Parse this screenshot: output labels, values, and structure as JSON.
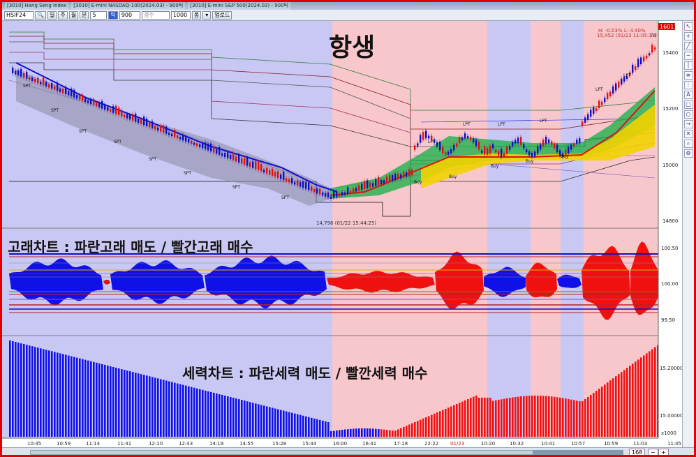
{
  "window": {
    "tabs": [
      "[3010] Hang Seng Index",
      "[3010] E-mini NASDAQ-100(2024.03) - 900틱",
      "[3010] E-mini S&P 500(2024.03) - 900틱"
    ]
  },
  "toolbar": {
    "symbol": "HSIF24",
    "buttons": [
      "일",
      "주",
      "월",
      "분",
      "틱"
    ],
    "interval": "5",
    "tick_count": "900",
    "type_label": "갱수",
    "count_value": "1000",
    "count_unit": "봉",
    "update_label": "업로드"
  },
  "title": "항생",
  "legend": {
    "high_low": "H: -0.03%  L: 4.40%",
    "last_info": "15,452 (01/23 11:05:11)",
    "last_sub": "74",
    "current_price": "16011"
  },
  "annotations": {
    "low_marker": "14,796 (01/22 15:44:25)"
  },
  "panels": {
    "whale_title": "고래차트 : 파란고래 매도 / 빨간고래 매수",
    "force_title": "세력차트 : 파란세력 매도 / 빨깐세력 매수"
  },
  "axes": {
    "price_ticks": [
      "15400",
      "15200",
      "15000",
      "14800"
    ],
    "whale_ticks": [
      "100.50",
      "100.00",
      "99.50"
    ],
    "force_ticks": [
      "15.20000",
      "15.00000"
    ],
    "force_unit": "x1000",
    "time_ticks": [
      "10:45",
      "10:59",
      "11:14",
      "11:41",
      "12:10",
      "12:43",
      "14:19",
      "14:55",
      "15:28",
      "15:44",
      "16:00",
      "16:41",
      "17:18",
      "22:22",
      "01/23",
      "10:20",
      "10:32",
      "10:41",
      "10:57",
      "10:59",
      "11:03",
      "11:05"
    ]
  },
  "bottom": {
    "scroll_value": "168"
  },
  "colors": {
    "sell_blue": "#1010e8",
    "buy_red": "#f01010",
    "bg_blue": "#c9c8f4",
    "bg_pink": "#f7c7cc",
    "frame": "#e00000"
  },
  "icons": [
    "arrow-cursor-icon",
    "crosshair-icon",
    "line-tool-icon",
    "zoom-icon",
    "settings-icon"
  ]
}
